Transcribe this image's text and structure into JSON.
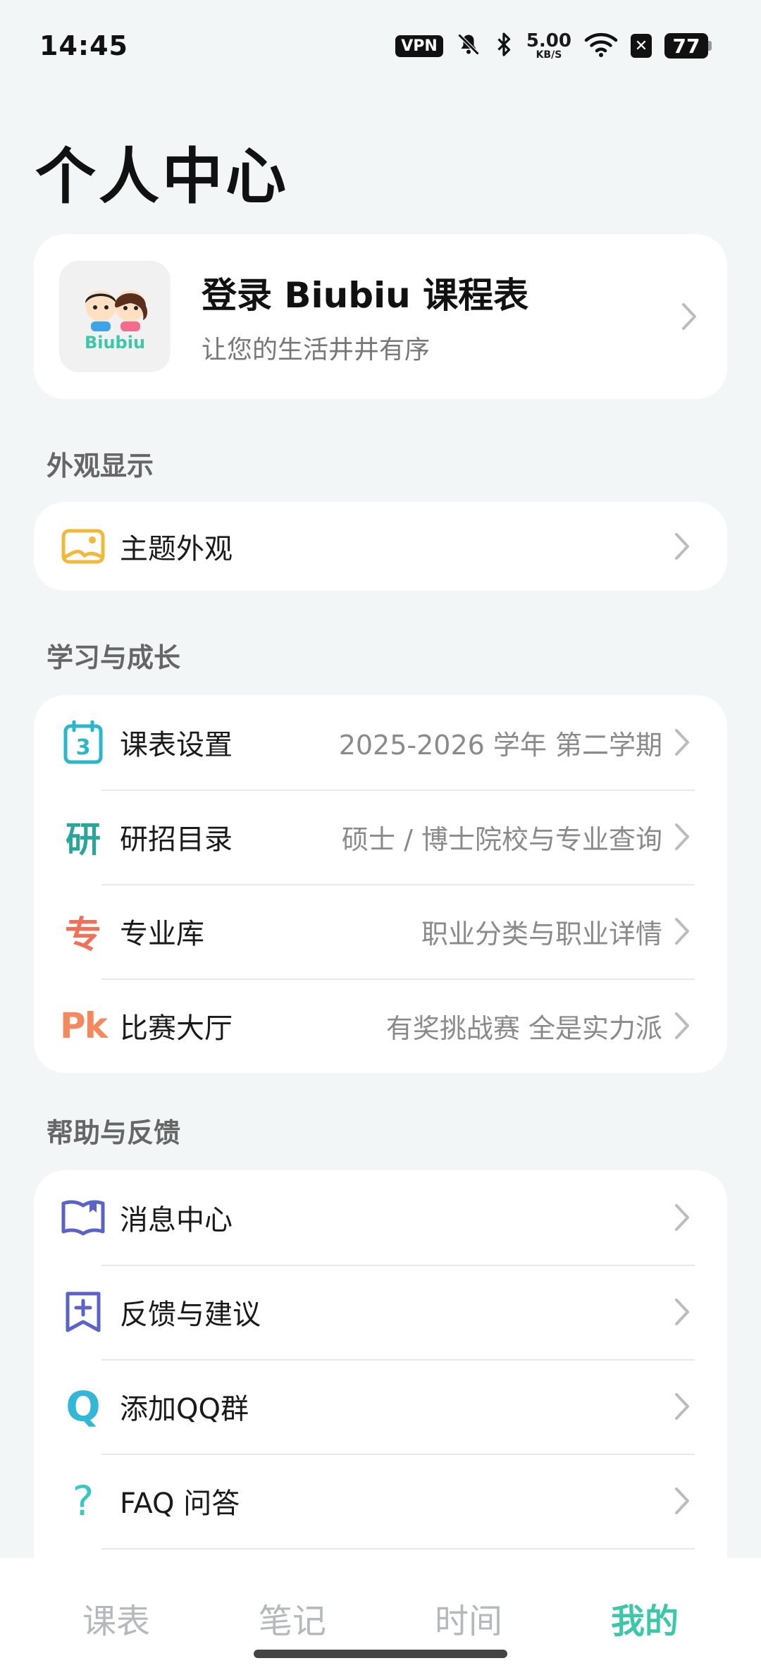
{
  "status_bar": {
    "time": "14:45",
    "vpn": "VPN",
    "speed_value": "5.00",
    "speed_unit": "KB/S",
    "battery": "77",
    "icons": [
      "mute-bell-icon",
      "bluetooth-icon",
      "wifi-icon",
      "x-app-icon"
    ]
  },
  "page": {
    "title": "个人中心"
  },
  "login": {
    "title": "登录 Biubiu 课程表",
    "subtitle": "让您的生活井井有序",
    "avatar_text": "Biubiu"
  },
  "sections": {
    "appearance": {
      "label": "外观显示",
      "items": [
        {
          "label": "主题外观",
          "value": "",
          "icon": "image-icon"
        }
      ]
    },
    "study": {
      "label": "学习与成长",
      "items": [
        {
          "label": "课表设置",
          "value": "2025-2026 学年 第二学期",
          "icon": "calendar-icon",
          "icon_text": "3"
        },
        {
          "label": "研招目录",
          "value": "硕士 / 博士院校与专业查询",
          "icon": "yan-icon",
          "icon_text": "研"
        },
        {
          "label": "专业库",
          "value": "职业分类与职业详情",
          "icon": "zhuan-icon",
          "icon_text": "专"
        },
        {
          "label": "比赛大厅",
          "value": "有奖挑战赛 全是实力派",
          "icon": "pk-icon",
          "icon_text": "Pk"
        }
      ]
    },
    "help": {
      "label": "帮助与反馈",
      "items": [
        {
          "label": "消息中心",
          "value": "",
          "icon": "book-icon"
        },
        {
          "label": "反馈与建议",
          "value": "",
          "icon": "bookmark-plus-icon"
        },
        {
          "label": "添加QQ群",
          "value": "",
          "icon": "qq-icon",
          "icon_text": "Q"
        },
        {
          "label": "FAQ 问答",
          "value": "",
          "icon": "question-icon",
          "icon_text": "?"
        }
      ]
    }
  },
  "bottom_nav": {
    "items": [
      {
        "label": "课表",
        "active": false
      },
      {
        "label": "笔记",
        "active": false
      },
      {
        "label": "时间",
        "active": false
      },
      {
        "label": "我的",
        "active": true
      }
    ]
  },
  "colors": {
    "accent": "#3dc7a9",
    "background": "#f2f6f6",
    "theme_icon": "#f0b93a",
    "calendar_icon": "#2bb6c9",
    "yan_icon": "#2aa59a",
    "zhuan_icon": "#f0705a",
    "pk_icon": "#f4895f",
    "book_icon": "#5b63c9",
    "qq_icon": "#32b7d6",
    "faq_icon": "#38c7c2"
  }
}
